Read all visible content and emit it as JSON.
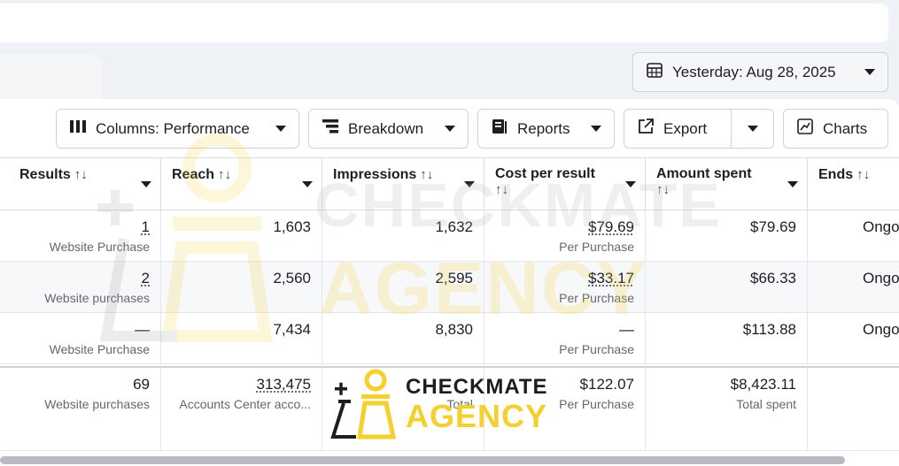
{
  "date_picker": {
    "label": "Yesterday: Aug 28, 2025"
  },
  "toolbar": {
    "columns_label": "Columns: Performance",
    "breakdown_label": "Breakdown",
    "reports_label": "Reports",
    "export_label": "Export",
    "charts_label": "Charts"
  },
  "table": {
    "headers": {
      "results": "Results",
      "reach": "Reach",
      "impressions": "Impressions",
      "cost_per_result": "Cost per result",
      "amount_spent": "Amount spent",
      "ends": "Ends",
      "sort_glyph": "↑↓"
    },
    "rows": [
      {
        "results": "1",
        "results_sub": "Website Purchase",
        "reach": "1,603",
        "impressions": "1,632",
        "cost": "$79.69",
        "cost_sub": "Per Purchase",
        "spent": "$79.69",
        "ends": "Ongo"
      },
      {
        "results": "2",
        "results_sub": "Website purchases",
        "reach": "2,560",
        "impressions": "2,595",
        "cost": "$33.17",
        "cost_sub": "Per Purchase",
        "spent": "$66.33",
        "ends": "Ongo"
      },
      {
        "results": "—",
        "results_sub": "Website Purchase",
        "reach": "7,434",
        "impressions": "8,830",
        "cost": "—",
        "cost_sub": "Per Purchase",
        "spent": "$113.88",
        "ends": "Ongo"
      }
    ],
    "total": {
      "results": "69",
      "results_sub": "Website purchases",
      "reach": "313,475",
      "reach_sub": "Accounts Center acco...",
      "impressions_sub": "Total",
      "cost": "$122.07",
      "cost_sub": "Per Purchase",
      "spent": "$8,423.11",
      "spent_sub": "Total spent"
    }
  },
  "watermark": {
    "line1": "CHECKMATE",
    "line2": "AGENCY"
  },
  "colors": {
    "accent_yellow": "#f5cf2b",
    "border": "#cfd3d9"
  },
  "icons": {
    "date": "calendar-icon",
    "columns": "columns-icon",
    "breakdown": "breakdown-icon",
    "reports": "reports-icon",
    "export": "export-icon",
    "charts": "chart-icon"
  }
}
